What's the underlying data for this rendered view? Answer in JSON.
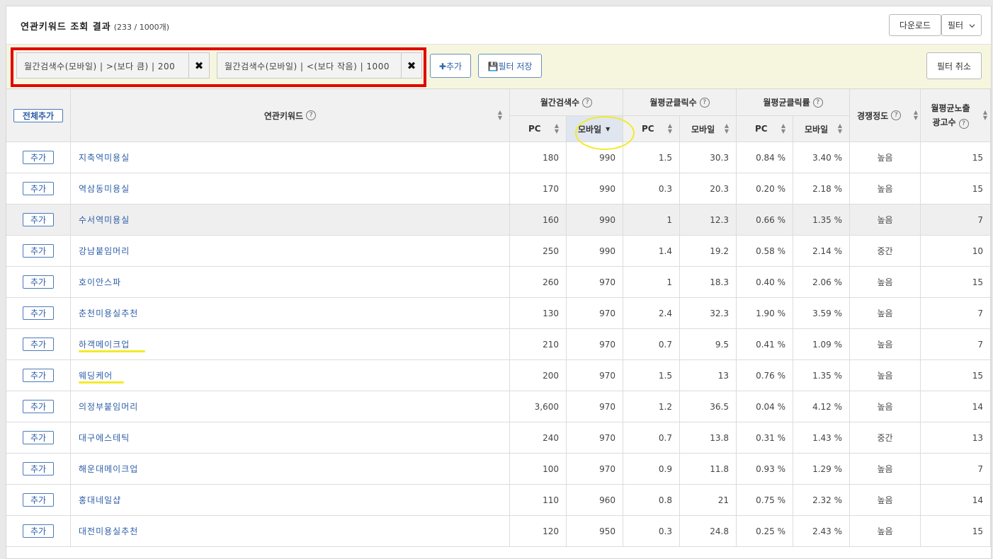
{
  "header": {
    "title": "연관키워드 조회 결과",
    "count": "(233 / 1000개)",
    "download_label": "다운로드",
    "filter_label": "필터"
  },
  "filters": {
    "chips": [
      {
        "label": "월간검색수(모바일) | >(보다 큼) | 200"
      },
      {
        "label": "월간검색수(모바일) | <(보다 작음) | 1000"
      }
    ],
    "add_label": "✚추가",
    "save_label": "💾필터 저장",
    "cancel_label": "필터 취소"
  },
  "table": {
    "add_all_label": "전체추가",
    "headers": {
      "keyword": "연관키워드",
      "monthly_search": "월간검색수",
      "avg_clicks": "월평균클릭수",
      "avg_ctr": "월평균클릭률",
      "competition": "경쟁정도",
      "ad_count_line1": "월평균노출",
      "ad_count_line2": "광고수",
      "pc": "PC",
      "mobile": "모바일"
    },
    "row_add_label": "추가",
    "rows": [
      {
        "keyword": "지축역미용실",
        "search_pc": "180",
        "search_mo": "990",
        "click_pc": "1.5",
        "click_mo": "30.3",
        "ctr_pc": "0.84 %",
        "ctr_mo": "3.40 %",
        "comp": "높음",
        "ads": "15"
      },
      {
        "keyword": "역삼동미용실",
        "search_pc": "170",
        "search_mo": "990",
        "click_pc": "0.3",
        "click_mo": "20.3",
        "ctr_pc": "0.20 %",
        "ctr_mo": "2.18 %",
        "comp": "높음",
        "ads": "15"
      },
      {
        "keyword": "수서역미용실",
        "search_pc": "160",
        "search_mo": "990",
        "click_pc": "1",
        "click_mo": "12.3",
        "ctr_pc": "0.66 %",
        "ctr_mo": "1.35 %",
        "comp": "높음",
        "ads": "7"
      },
      {
        "keyword": "강남붙임머리",
        "search_pc": "250",
        "search_mo": "990",
        "click_pc": "1.4",
        "click_mo": "19.2",
        "ctr_pc": "0.58 %",
        "ctr_mo": "2.14 %",
        "comp": "중간",
        "ads": "10"
      },
      {
        "keyword": "호이안스파",
        "search_pc": "260",
        "search_mo": "970",
        "click_pc": "1",
        "click_mo": "18.3",
        "ctr_pc": "0.40 %",
        "ctr_mo": "2.06 %",
        "comp": "높음",
        "ads": "15"
      },
      {
        "keyword": "춘천미용실추천",
        "search_pc": "130",
        "search_mo": "970",
        "click_pc": "2.4",
        "click_mo": "32.3",
        "ctr_pc": "1.90 %",
        "ctr_mo": "3.59 %",
        "comp": "높음",
        "ads": "7"
      },
      {
        "keyword": "하객메이크업",
        "search_pc": "210",
        "search_mo": "970",
        "click_pc": "0.7",
        "click_mo": "9.5",
        "ctr_pc": "0.41 %",
        "ctr_mo": "1.09 %",
        "comp": "높음",
        "ads": "7"
      },
      {
        "keyword": "웨딩케어",
        "search_pc": "200",
        "search_mo": "970",
        "click_pc": "1.5",
        "click_mo": "13",
        "ctr_pc": "0.76 %",
        "ctr_mo": "1.35 %",
        "comp": "높음",
        "ads": "15"
      },
      {
        "keyword": "의정부붙임머리",
        "search_pc": "3,600",
        "search_mo": "970",
        "click_pc": "1.2",
        "click_mo": "36.5",
        "ctr_pc": "0.04 %",
        "ctr_mo": "4.12 %",
        "comp": "높음",
        "ads": "14"
      },
      {
        "keyword": "대구에스테틱",
        "search_pc": "240",
        "search_mo": "970",
        "click_pc": "0.7",
        "click_mo": "13.8",
        "ctr_pc": "0.31 %",
        "ctr_mo": "1.43 %",
        "comp": "중간",
        "ads": "13"
      },
      {
        "keyword": "해운대메이크업",
        "search_pc": "100",
        "search_mo": "970",
        "click_pc": "0.9",
        "click_mo": "11.8",
        "ctr_pc": "0.93 %",
        "ctr_mo": "1.29 %",
        "comp": "높음",
        "ads": "7"
      },
      {
        "keyword": "홍대네일샵",
        "search_pc": "110",
        "search_mo": "960",
        "click_pc": "0.8",
        "click_mo": "21",
        "ctr_pc": "0.75 %",
        "ctr_mo": "2.32 %",
        "comp": "높음",
        "ads": "14"
      },
      {
        "keyword": "대전미용실추천",
        "search_pc": "120",
        "search_mo": "950",
        "click_pc": "0.3",
        "click_mo": "24.8",
        "ctr_pc": "0.25 %",
        "ctr_mo": "2.43 %",
        "comp": "높음",
        "ads": "15"
      }
    ]
  },
  "colors": {
    "highlight_red": "#e20000",
    "highlight_yellow": "#f3ea2a",
    "link_blue": "#2d5ea8",
    "filter_bar_bg": "#f6f6df",
    "sorted_header_bg": "#dfe6ef",
    "hover_row_bg": "#efefef"
  }
}
